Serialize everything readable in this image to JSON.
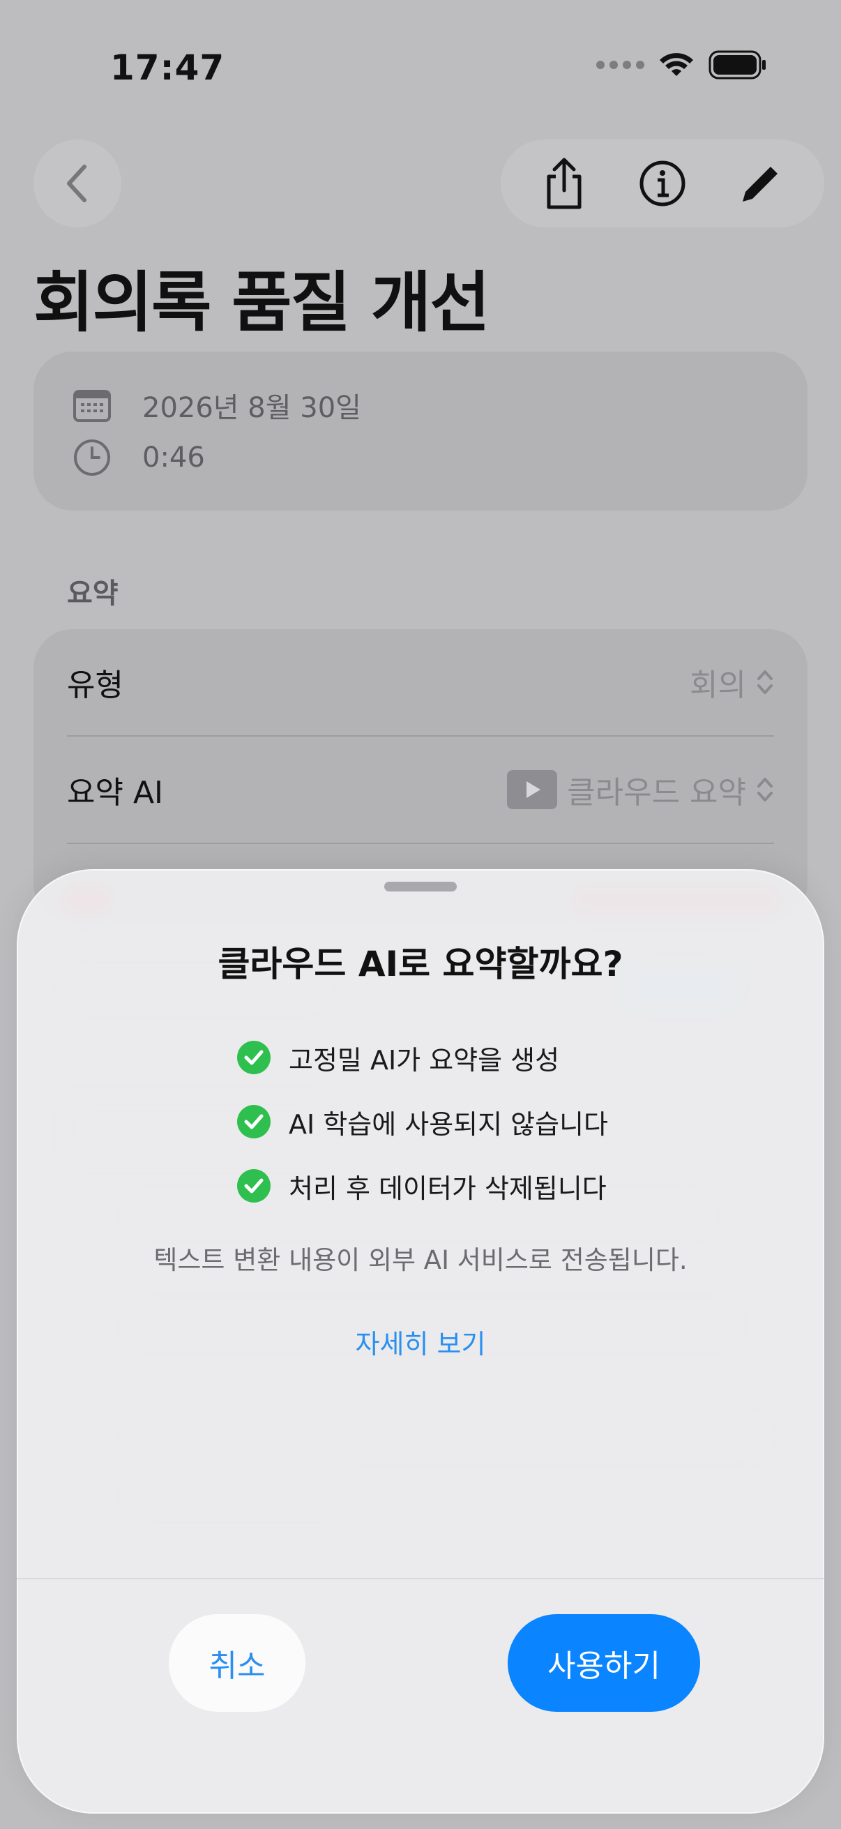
{
  "status_bar": {
    "time": "17:47"
  },
  "nav": {
    "back_icon": "chevron-left-icon",
    "share_icon": "share-icon",
    "info_icon": "info-icon",
    "edit_icon": "pencil-icon"
  },
  "page": {
    "title": "회의록 품질 개선"
  },
  "info": {
    "date": "2026년 8월 30일",
    "duration": "0:46"
  },
  "summary_section": {
    "label": "요약",
    "rows": [
      {
        "label": "유형",
        "value": "회의"
      },
      {
        "label": "요약 AI",
        "value": "클라우드 요약"
      }
    ]
  },
  "sheet": {
    "title": "클라우드 AI로 요약할까요?",
    "checks": [
      "고정밀 AI가 요약을 생성",
      "AI 학습에 사용되지 않습니다",
      "처리 후 데이터가 삭제됩니다"
    ],
    "notice": "텍스트 변환 내용이 외부 AI 서비스로 전송됩니다.",
    "more_link": "자세히 보기",
    "cancel_label": "취소",
    "confirm_label": "사용하기"
  },
  "colors": {
    "accent": "#0a84ff",
    "check": "#2fbf4f",
    "link": "#2a8ff0"
  }
}
